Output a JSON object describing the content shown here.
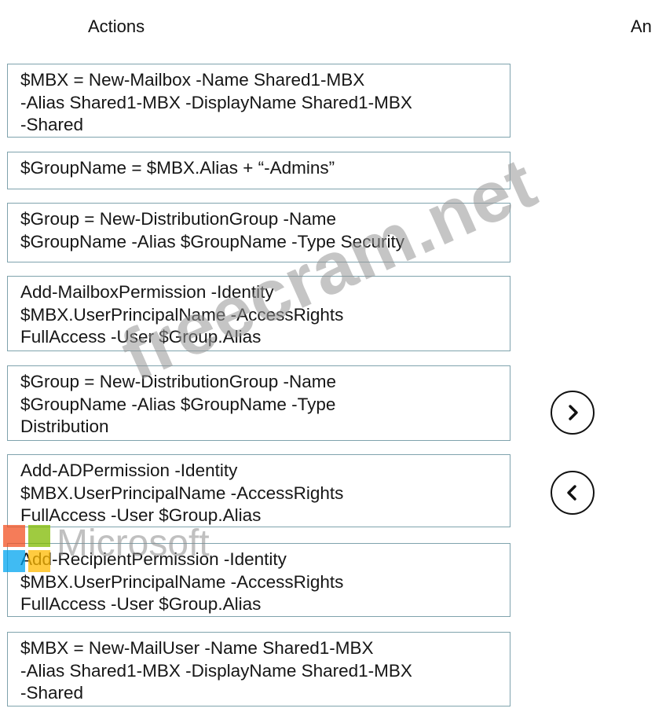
{
  "headings": {
    "actions": "Actions",
    "answer": "An"
  },
  "actions": [
    {
      "lines": [
        "$MBX = New-Mailbox -Name Shared1-MBX",
        "-Alias Shared1-MBX -DisplayName Shared1-MBX",
        "-Shared"
      ]
    },
    {
      "lines": [
        "$GroupName = $MBX.Alias + “-Admins”"
      ]
    },
    {
      "lines": [
        "$Group = New-DistributionGroup -Name",
        "$GroupName -Alias $GroupName -Type Security"
      ]
    },
    {
      "lines": [
        "Add-MailboxPermission -Identity",
        "$MBX.UserPrincipalName -AccessRights",
        "FullAccess -User $Group.Alias"
      ]
    },
    {
      "lines": [
        "$Group = New-DistributionGroup -Name",
        "$GroupName -Alias $GroupName -Type",
        "Distribution"
      ]
    },
    {
      "lines": [
        "Add-ADPermission -Identity",
        "$MBX.UserPrincipalName -AccessRights",
        "FullAccess -User $Group.Alias"
      ]
    },
    {
      "lines": [
        "Add-RecipientPermission -Identity",
        "$MBX.UserPrincipalName -AccessRights",
        "FullAccess -User $Group.Alias"
      ]
    },
    {
      "lines": [
        "$MBX = New-MailUser -Name Shared1-MBX",
        "-Alias Shared1-MBX -DisplayName Shared1-MBX",
        "-Shared"
      ]
    }
  ],
  "buttons": {
    "move_right_icon": "chevron-right-icon",
    "move_left_icon": "chevron-left-icon"
  },
  "watermarks": {
    "site": "freecram.net",
    "brand": "Microsoft"
  },
  "colors": {
    "box_border": "#7fa3ad",
    "ms_red": "#f25022",
    "ms_green": "#7fba00",
    "ms_blue": "#00a4ef",
    "ms_yellow": "#ffb900"
  }
}
